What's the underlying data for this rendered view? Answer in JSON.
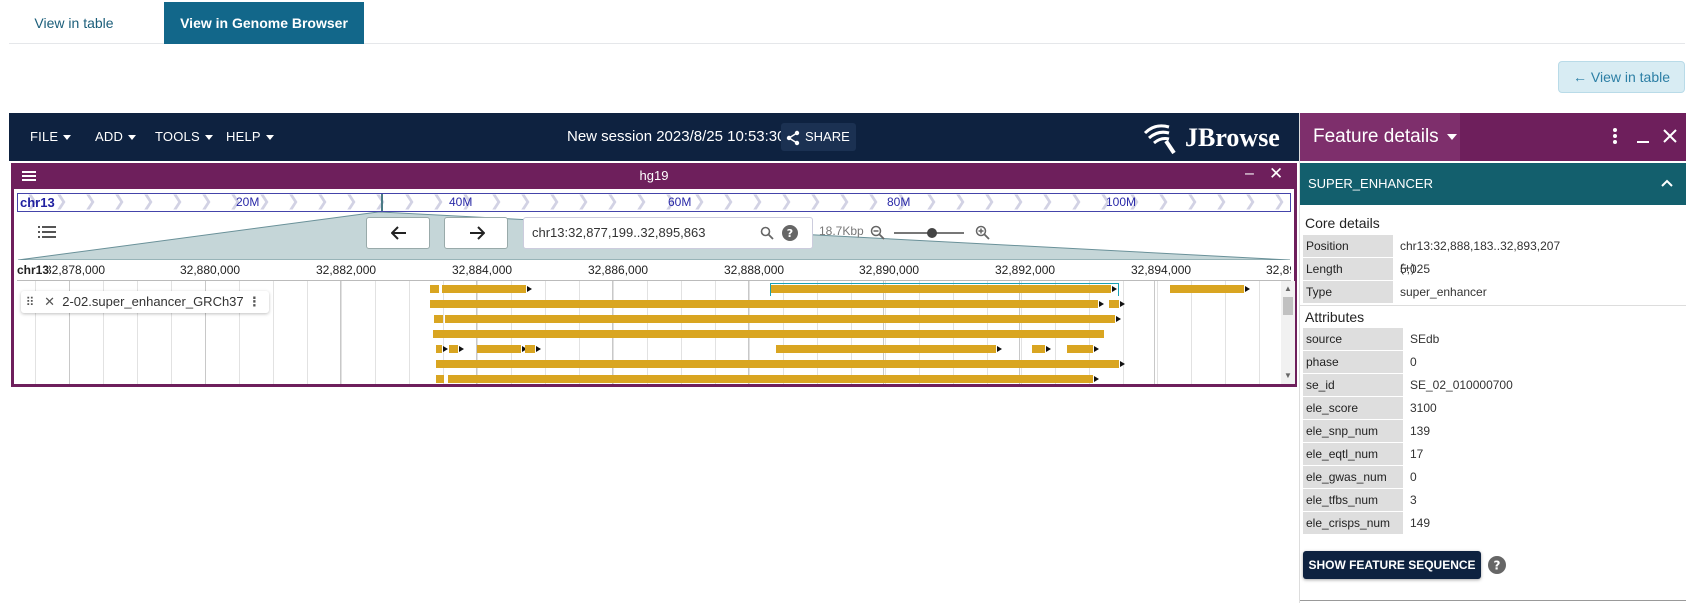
{
  "tabs": {
    "table": "View in table",
    "genome": "View in Genome Browser"
  },
  "back_button": "← View in table",
  "appbar": {
    "menus": [
      "FILE",
      "ADD",
      "TOOLS",
      "HELP"
    ],
    "session": "New session 2023/8/25 10:53:30",
    "share": "SHARE",
    "logo": "JBrowse"
  },
  "view": {
    "assembly": "hg19",
    "overview": {
      "chr": "chr13",
      "labels": [
        "20M",
        "40M",
        "60M",
        "80M",
        "100M"
      ]
    },
    "locstring": "chr13:32,877,199..32,895,863",
    "span": "18.7Kbp",
    "ruler": {
      "chr": "chr13",
      "ticks": [
        "32,878,000",
        "32,880,000",
        "32,882,000",
        "32,884,000",
        "32,886,000",
        "32,888,000",
        "32,890,000",
        "32,892,000",
        "32,894,000",
        "32,89"
      ]
    },
    "track_name": "2-02.super_enhancer_GRCh37"
  },
  "drawer": {
    "title": "Feature details",
    "section": "SUPER_ENHANCER",
    "core_title": "Core details",
    "core": [
      {
        "key": "Position",
        "value": "chr13:32,888,183..32,893,207 (+)"
      },
      {
        "key": "Length",
        "value": "5,025"
      },
      {
        "key": "Type",
        "value": "super_enhancer"
      }
    ],
    "attr_title": "Attributes",
    "attributes": [
      {
        "key": "source",
        "value": "SEdb"
      },
      {
        "key": "phase",
        "value": "0"
      },
      {
        "key": "se_id",
        "value": "SE_02_010000700"
      },
      {
        "key": "ele_score",
        "value": "3100"
      },
      {
        "key": "ele_snp_num",
        "value": "139"
      },
      {
        "key": "ele_eqtl_num",
        "value": "17"
      },
      {
        "key": "ele_gwas_num",
        "value": "0"
      },
      {
        "key": "ele_tfbs_num",
        "value": "3"
      },
      {
        "key": "ele_crisps_num",
        "value": "149"
      }
    ],
    "sequence_button": "SHOW FEATURE SEQUENCE"
  },
  "colors": {
    "appbar": "#0e2240",
    "view_header": "#6e1f5c",
    "section": "#135f6d",
    "feature": "#d9a521"
  }
}
